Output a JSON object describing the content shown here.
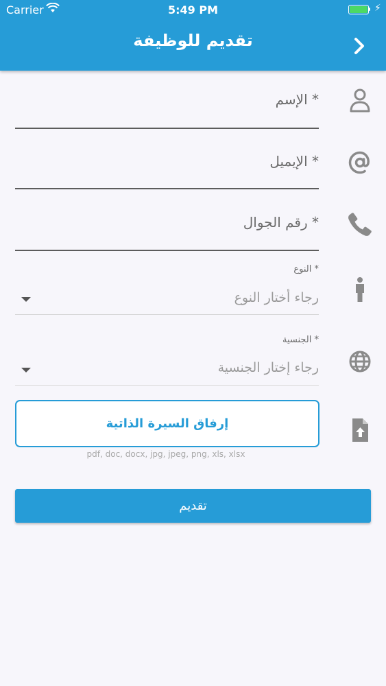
{
  "status_bar": {
    "carrier": "Carrier",
    "time": "5:49 PM"
  },
  "header": {
    "title": "تقديم للوظيفة",
    "back_icon": "chevron-right-icon"
  },
  "form": {
    "name": {
      "label": "الإسم *",
      "icon": "person-icon"
    },
    "email": {
      "label": "الإيميل *",
      "icon": "at-icon"
    },
    "mobile": {
      "label": "رقم الجوال *",
      "icon": "phone-icon"
    },
    "gender": {
      "label": "النوع *",
      "placeholder": "رجاء أختار النوع",
      "icon": "person-standing-icon"
    },
    "nationality": {
      "label": "الجنسية *",
      "placeholder": "رجاء إختار الجنسية",
      "icon": "globe-icon"
    },
    "cv": {
      "button_label": "إرفاق السيرة الذاتية",
      "formats": "pdf, doc, docx, jpg, jpeg, png, xls, xlsx",
      "icon": "file-upload-icon"
    },
    "submit_label": "تقديم"
  },
  "colors": {
    "primary": "#269cd7",
    "background": "#f7f6fb",
    "icon": "#8a8a8a"
  }
}
